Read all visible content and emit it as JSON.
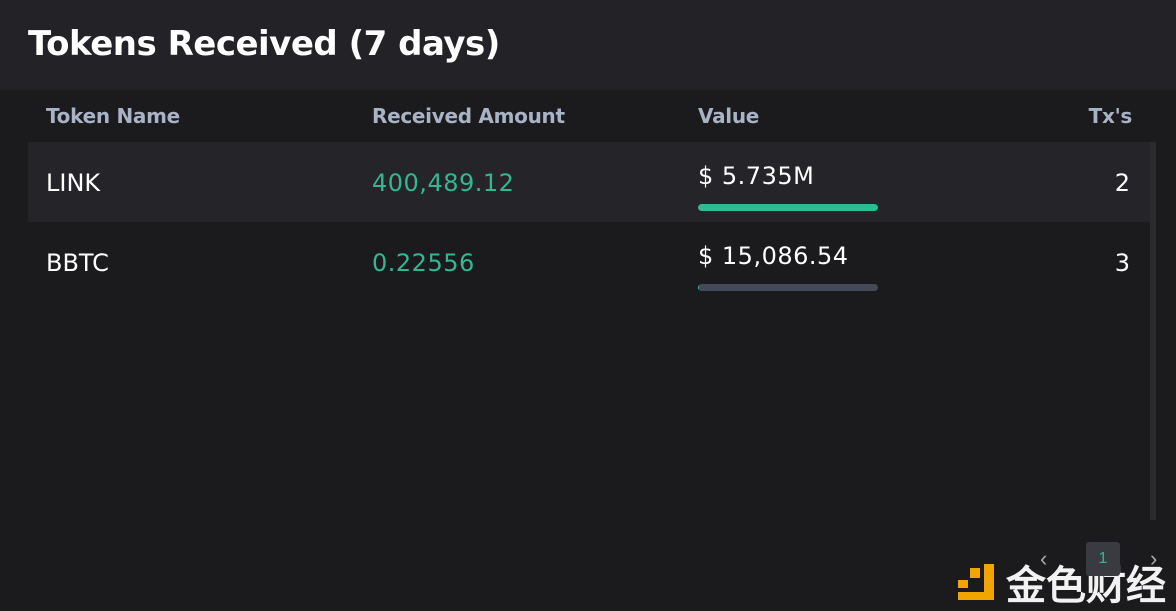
{
  "header": {
    "title": "Tokens Received (7 days)"
  },
  "table": {
    "columns": [
      "Token Name",
      "Received Amount",
      "Value",
      "Tx's"
    ],
    "rows": [
      {
        "token": "LINK",
        "amount": "400,489.12",
        "value": "$ 5.735M",
        "value_share": 1.0,
        "txs": "2"
      },
      {
        "token": "BBTC",
        "amount": "0.22556",
        "value": "$ 15,086.54",
        "value_share": 0.0026,
        "txs": "3"
      }
    ]
  },
  "pagination": {
    "current_page": "1",
    "prev_icon": "chevron-left-icon",
    "next_icon": "chevron-right-icon"
  },
  "watermark": {
    "text": "金色财经"
  },
  "colors": {
    "accent": "#2cbc96",
    "amount": "#34b690",
    "bar_track": "#444a55"
  }
}
